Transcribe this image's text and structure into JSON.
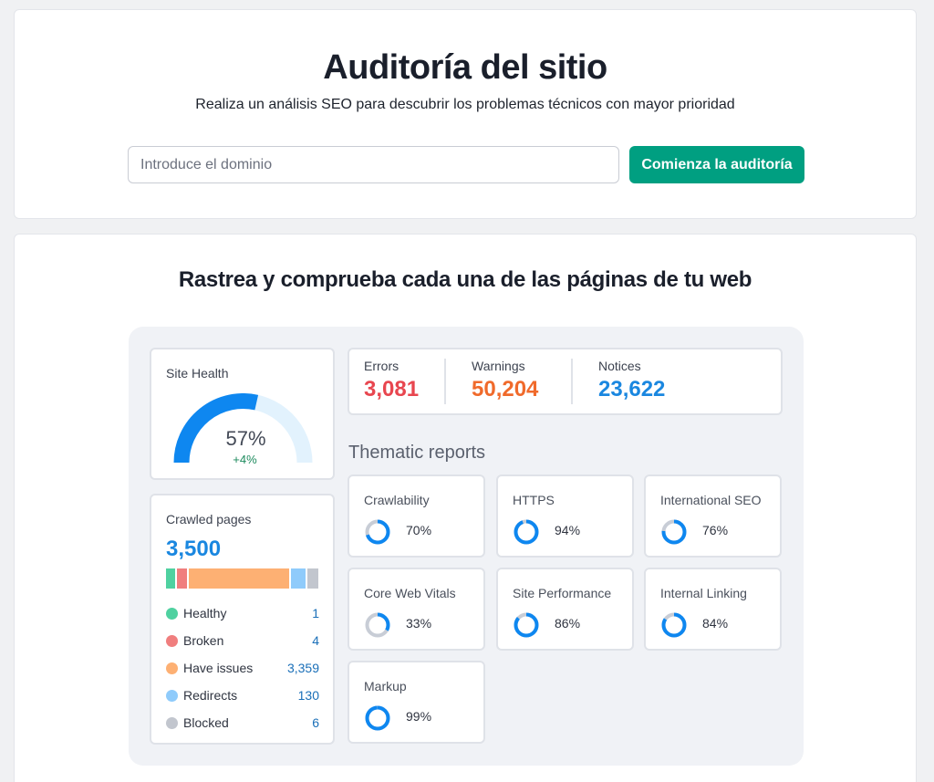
{
  "header": {
    "title": "Auditoría del sitio",
    "subtitle": "Realiza un análisis SEO para descubrir los problemas técnicos con mayor prioridad",
    "input_placeholder": "Introduce el dominio",
    "button_label": "Comienza la auditoría"
  },
  "main": {
    "title": "Rastrea y comprueba cada una de las páginas de tu web"
  },
  "site_health": {
    "label": "Site Health",
    "value": "57%",
    "change": "+4%",
    "percent": 57
  },
  "crawled": {
    "label": "Crawled pages",
    "total": "3,500",
    "items": [
      {
        "name": "Healthy",
        "count": "1",
        "color": "#4fd1a0"
      },
      {
        "name": "Broken",
        "count": "4",
        "color": "#f07e7e"
      },
      {
        "name": "Have issues",
        "count": "3,359",
        "color": "#fdb073"
      },
      {
        "name": "Redirects",
        "count": "130",
        "color": "#8fcbfb"
      },
      {
        "name": "Blocked",
        "count": "6",
        "color": "#c2c6ce"
      }
    ]
  },
  "stats": {
    "errors_label": "Errors",
    "errors_value": "3,081",
    "warnings_label": "Warnings",
    "warnings_value": "50,204",
    "notices_label": "Notices",
    "notices_value": "23,622"
  },
  "thematic": {
    "title": "Thematic reports",
    "reports": [
      {
        "name": "Crawlability",
        "value": "70%",
        "percent": 70
      },
      {
        "name": "HTTPS",
        "value": "94%",
        "percent": 94
      },
      {
        "name": "International SEO",
        "value": "76%",
        "percent": 76
      },
      {
        "name": "Core Web Vitals",
        "value": "33%",
        "percent": 33
      },
      {
        "name": "Site Performance",
        "value": "86%",
        "percent": 86
      },
      {
        "name": "Internal Linking",
        "value": "84%",
        "percent": 84
      },
      {
        "name": "Markup",
        "value": "99%",
        "percent": 99
      }
    ]
  },
  "colors": {
    "accent_green": "#009f81",
    "errors": "#e8464f",
    "warnings": "#f06a2b",
    "notices": "#1a87e0",
    "gauge_fill": "#0e87f0",
    "gauge_track": "#e2f2fd",
    "ring_track": "#c8cdd6"
  }
}
